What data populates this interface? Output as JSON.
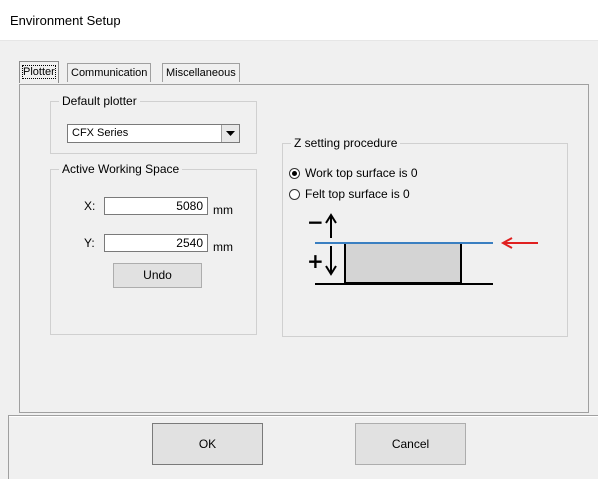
{
  "window": {
    "title": "Environment Setup"
  },
  "tabs": [
    {
      "label": "Plotter",
      "active": true
    },
    {
      "label": "Communication",
      "active": false
    },
    {
      "label": "Miscellaneous",
      "active": false
    }
  ],
  "default_plotter": {
    "legend": "Default plotter",
    "selected": "CFX Series"
  },
  "working_space": {
    "legend": "Active Working Space",
    "x_label": "X:",
    "x_value": "5080",
    "y_label": "Y:",
    "y_value": "2540",
    "unit": "mm",
    "undo_label": "Undo"
  },
  "z_setting": {
    "legend": "Z setting procedure",
    "options": [
      {
        "label": "Work top surface is 0",
        "selected": true
      },
      {
        "label": "Felt top surface is 0",
        "selected": false
      }
    ],
    "diagram": {
      "minus_sign": "−",
      "plus_sign": "+",
      "line_color": "#3a7fc1",
      "arrow_color": "#e02020",
      "block_fill": "#d4d4d4"
    }
  },
  "buttons": {
    "ok": "OK",
    "cancel": "Cancel"
  }
}
